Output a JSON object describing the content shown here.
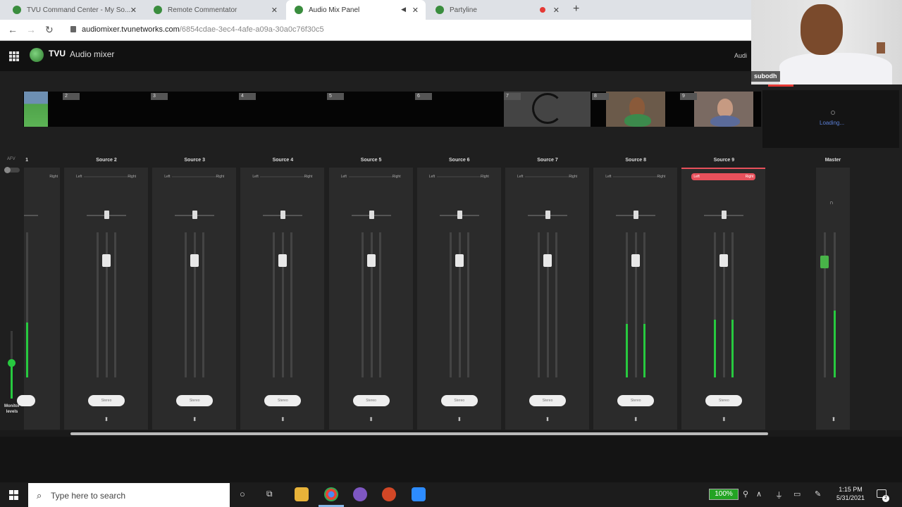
{
  "browser": {
    "tabs": [
      {
        "title": "TVU Command Center - My So..."
      },
      {
        "title": "Remote Commentator"
      },
      {
        "title": "Audio Mix Panel"
      },
      {
        "title": "Partyline"
      }
    ],
    "url_host": "audiomixer.tvunetworks.com",
    "url_path": "/6854cdae-3ec4-4afe-a09a-30a0c76f30c5"
  },
  "app": {
    "brand": "TVU",
    "title": "Audio mixer",
    "header_right": "Audi"
  },
  "webcam": {
    "name": "subodh"
  },
  "video_strip": {
    "slots": [
      "2",
      "3",
      "4",
      "5",
      "6",
      "7",
      "8",
      "9"
    ],
    "loading_text": "Loading..."
  },
  "mixer": {
    "afv_label": "AFV",
    "monitor_label": "Monitor levels",
    "first_channel_label": "1",
    "channels": [
      {
        "name": "Source 2",
        "left": "Left",
        "right": "Right",
        "mode": "Stereo",
        "meter_level": 0
      },
      {
        "name": "Source 3",
        "left": "Left",
        "right": "Right",
        "mode": "Stereo",
        "meter_level": 0
      },
      {
        "name": "Source 4",
        "left": "Left",
        "right": "Right",
        "mode": "Stereo",
        "meter_level": 0
      },
      {
        "name": "Source 5",
        "left": "Left",
        "right": "Right",
        "mode": "Stereo",
        "meter_level": 0
      },
      {
        "name": "Source 6",
        "left": "Left",
        "right": "Right",
        "mode": "Stereo",
        "meter_level": 0
      },
      {
        "name": "Source 7",
        "left": "Left",
        "right": "Right",
        "mode": "Stereo",
        "meter_level": 0
      },
      {
        "name": "Source 8",
        "left": "Left",
        "right": "Right",
        "mode": "Stereo",
        "meter_level": 0.37
      },
      {
        "name": "Source 9",
        "left": "Left",
        "right": "Right",
        "mode": "Stereo",
        "meter_level": 0.4,
        "active": true
      }
    ],
    "master": {
      "name": "Master",
      "meter_level": 0.46
    },
    "first_channel": {
      "right": "Right",
      "meter_level": 0.38
    }
  },
  "taskbar": {
    "search_placeholder": "Type here to search",
    "battery": "100%",
    "time": "1:15 PM",
    "date": "5/31/2021",
    "notifications": "2"
  },
  "colors": {
    "meter_green": "#27c93f",
    "active_channel": "#e8505b"
  }
}
